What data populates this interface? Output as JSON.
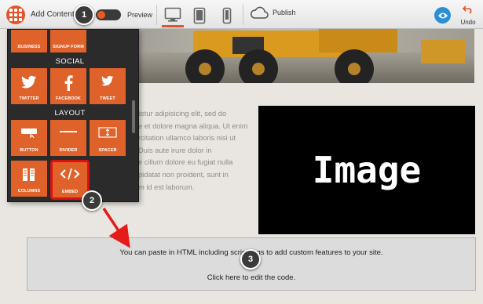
{
  "toolbar": {
    "add_content_label": "Add Content",
    "preview_label": "Preview",
    "publish_label": "Publish",
    "undo_label": "Undo",
    "accent_color": "#e0552a",
    "devices": [
      "desktop-icon",
      "tablet-icon",
      "phone-icon"
    ],
    "active_device": "desktop"
  },
  "panel": {
    "top_tiles": [
      "BUSINESS",
      "SIGNUP FORM"
    ],
    "sections": [
      {
        "title": "SOCIAL",
        "tiles": [
          "TWITTER",
          "FACEBOOK",
          "TWEET"
        ]
      },
      {
        "title": "LAYOUT",
        "tiles": [
          "BUTTON",
          "DIVIDER",
          "SPACER",
          "COLUMNS",
          "EMBED"
        ]
      }
    ]
  },
  "content": {
    "paragraph": [
      "tetur adipisicing elit, sed do",
      "e et dolore magna aliqua. Ut enim",
      "rcitation ullamco laboris nisi ut",
      "Duis aute irure dolor in",
      "e cillum dolore eu fugiat nulla",
      "pidatat non proident, sunt in",
      "m id est laborum."
    ],
    "image_placeholder": "Image",
    "embed_line1": "You can paste in HTML including script tags to add custom features to your site.",
    "embed_line2": "Click here to edit the code."
  },
  "callouts": [
    "1",
    "2",
    "3"
  ]
}
